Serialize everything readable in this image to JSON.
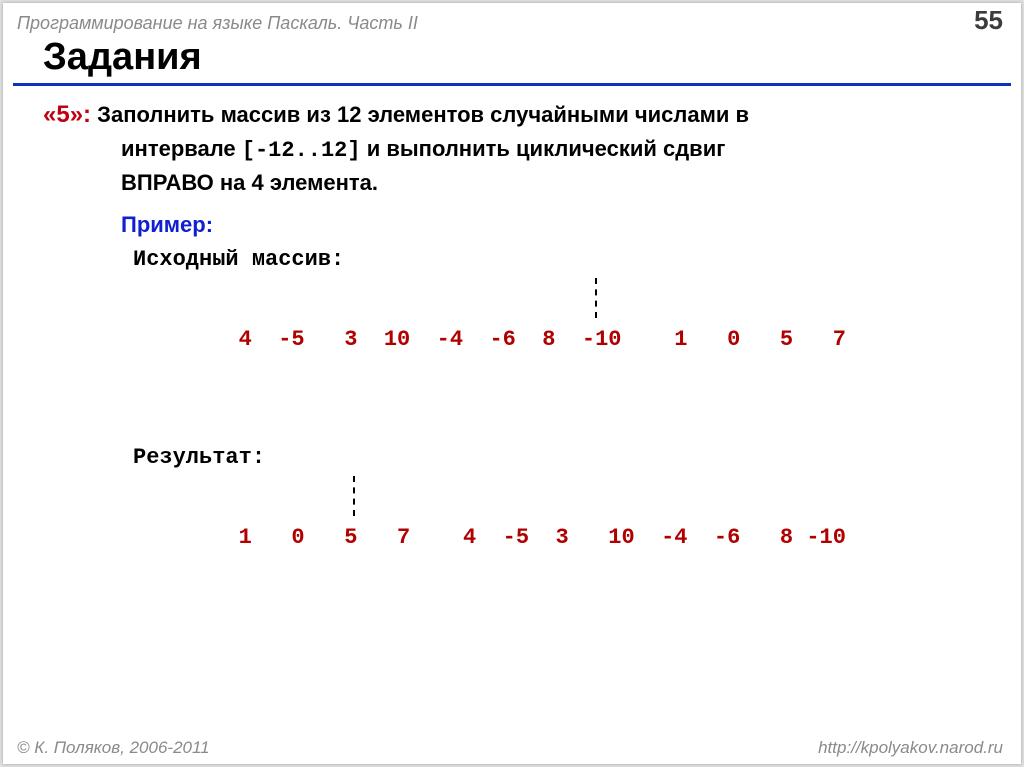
{
  "header": {
    "course": "Программирование на языке Паскаль. Часть II",
    "page": "55"
  },
  "title": "Задания",
  "task": {
    "mark": "«5»:",
    "line1a": "Заполнить массив из 12 элементов случайными числами в",
    "line2a": "интервале ",
    "interval": "[-12..12]",
    "line2b": " и выполнить циклический сдвиг",
    "line3": "ВПРАВО на 4 элемента."
  },
  "example": {
    "label": "Пример:",
    "src_label": "Исходный массив:",
    "src_data": "4  -5   3  10  -4  -6  8  -10    1   0   5   7",
    "res_label": "Результат:",
    "res_data": "1   0   5   7    4  -5  3   10  -4  -6   8 -10"
  },
  "footer": {
    "copyright": "© К. Поляков, 2006-2011",
    "url": "http://kpolyakov.narod.ru"
  }
}
